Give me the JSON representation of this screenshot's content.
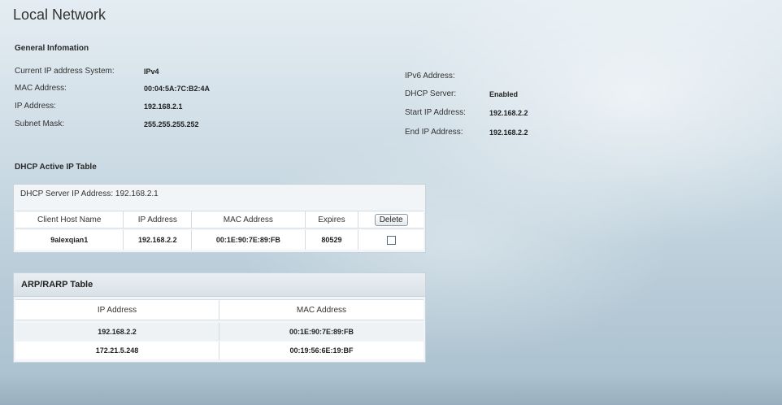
{
  "page": {
    "title": "Local Network"
  },
  "general": {
    "heading": "General Infomation",
    "left": [
      {
        "label": "Current IP address System:",
        "value": "IPv4"
      },
      {
        "label": "MAC Address:",
        "value": "00:04:5A:7C:B2:4A"
      },
      {
        "label": "IP Address:",
        "value": "192.168.2.1"
      },
      {
        "label": "Subnet Mask:",
        "value": "255.255.255.252"
      }
    ],
    "right": [
      {
        "label": "IPv6 Address:",
        "value": ""
      },
      {
        "label": "DHCP Server:",
        "value": "Enabled"
      },
      {
        "label": "Start IP Address:",
        "value": "192.168.2.2"
      },
      {
        "label": "End IP Address:",
        "value": "192.168.2.2"
      }
    ]
  },
  "dhcp_table": {
    "heading": "DHCP Active IP Table",
    "server_label": "DHCP Server IP Address:",
    "server_value": "192.168.2.1",
    "columns": [
      "Client Host Name",
      "IP Address",
      "MAC Address",
      "Expires"
    ],
    "delete_label": "Delete",
    "rows": [
      {
        "host": "9alexqian1",
        "ip": "192.168.2.2",
        "mac": "00:1E:90:7E:89:FB",
        "expires": "80529",
        "checked": false
      }
    ]
  },
  "arp_table": {
    "title": "ARP/RARP Table",
    "columns": [
      "IP Address",
      "MAC Address"
    ],
    "rows": [
      {
        "ip": "192.168.2.2",
        "mac": "00:1E:90:7E:89:FB"
      },
      {
        "ip": "172.21.5.248",
        "mac": "00:19:56:6E:19:BF"
      }
    ]
  }
}
